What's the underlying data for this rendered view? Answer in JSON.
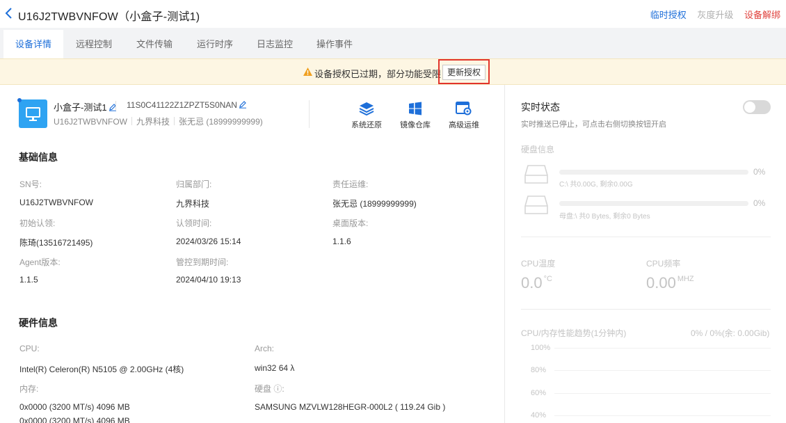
{
  "header": {
    "title": "U16J2TWBVNFOW（小盒子-测试1)",
    "actions": {
      "temp_auth": "临时授权",
      "gray_upgrade": "灰度升级",
      "unbind": "设备解绑"
    }
  },
  "tabs": [
    {
      "label": "设备详情",
      "active": true
    },
    {
      "label": "远程控制"
    },
    {
      "label": "文件传输"
    },
    {
      "label": "运行时序"
    },
    {
      "label": "日志监控"
    },
    {
      "label": "操作事件"
    }
  ],
  "banner": {
    "message": "设备授权已过期，部分功能受限",
    "button": "更新授权"
  },
  "device": {
    "name": "小盒子-测试1",
    "serial": "11S0C41122Z1ZPZT5S0NAN",
    "sn": "U16J2TWBVNFOW",
    "company": "九界科技",
    "owner": "张无忌 (18999999999)"
  },
  "tools": [
    {
      "label": "系统还原",
      "icon": "layers-icon"
    },
    {
      "label": "镜像仓库",
      "icon": "windows-icon"
    },
    {
      "label": "高级运维",
      "icon": "settings-window-icon"
    }
  ],
  "basic": {
    "title": "基础信息",
    "fields": [
      {
        "label": "SN号:",
        "value": "U16J2TWBVNFOW"
      },
      {
        "label": "归属部门:",
        "value": "九界科技"
      },
      {
        "label": "责任运维:",
        "value": "张无忌 (18999999999)"
      },
      {
        "label": "初始认领:",
        "value": "陈琦(13516721495)"
      },
      {
        "label": "认领时间:",
        "value": "2024/03/26 15:14"
      },
      {
        "label": "桌面版本:",
        "value": "1.1.6"
      },
      {
        "label": "Agent版本:",
        "value": "1.1.5"
      },
      {
        "label": "管控到期时间:",
        "value": "2024/04/10 19:13"
      }
    ]
  },
  "hardware": {
    "title": "硬件信息",
    "cpu_label": "CPU:",
    "cpu_value": "Intel(R) Celeron(R) N5105 @ 2.00GHz (4核)",
    "arch_label": "Arch:",
    "arch_value": "win32 64 λ",
    "mem_label": "内存:",
    "mem_values": [
      "0x0000 (3200 MT/s) 4096 MB",
      "0x0000 (3200 MT/s) 4096 MB"
    ],
    "disk_label": "硬盘 ⓘ:",
    "disk_value": "SAMSUNG MZVLW128HEGR-000L2 ( 119.24 Gib )"
  },
  "realtime": {
    "title": "实时状态",
    "subtitle": "实时推送已停止，可点击右侧切换按钮开启",
    "toggle_on": false,
    "disk_title": "硬盘信息",
    "disks": [
      {
        "percent": "0%",
        "usage": 0,
        "text": "C:\\ 共0.00G, 剩余0.00G"
      },
      {
        "percent": "0%",
        "usage": 0,
        "text": "母盘:\\ 共0 Bytes, 剩余0 Bytes"
      }
    ],
    "cpu_temp_label": "CPU温度",
    "cpu_temp_value": "0.0",
    "cpu_temp_unit": "°C",
    "cpu_freq_label": "CPU频率",
    "cpu_freq_value": "0.00",
    "cpu_freq_unit": "MHZ",
    "trend_title": "CPU/内存性能趋势(1分钟内)",
    "trend_summary": "0% / 0%(余: 0.00Gib)",
    "y_ticks": [
      "100%",
      "80%",
      "60%",
      "40%"
    ]
  },
  "colors": {
    "accent": "#1e6fd9",
    "danger": "#e0433e",
    "banner_bg": "#fdf6e3"
  }
}
